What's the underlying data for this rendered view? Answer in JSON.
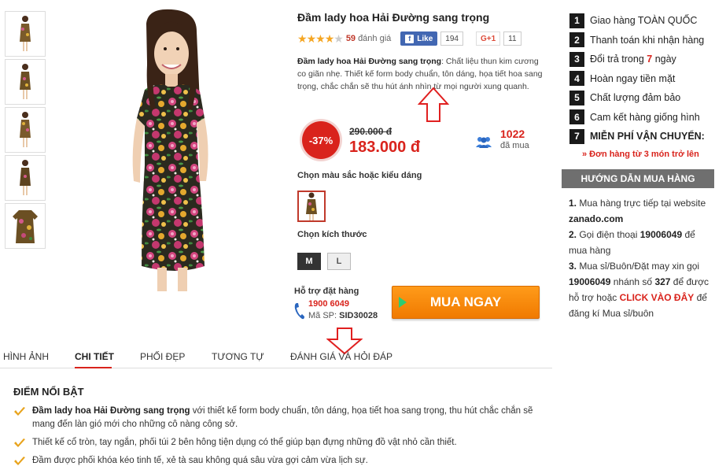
{
  "product": {
    "title": "Đầm lady hoa Hải Đường sang trọng",
    "rating_count": "59",
    "rating_label": "đánh giá",
    "rating_stars": 4,
    "fb_like_label": "Like",
    "fb_like_count": "194",
    "gplus_label": "G+1",
    "gplus_count": "11",
    "desc_bold": "Đầm lady hoa Hải Đường sang trọng",
    "desc_rest": ": Chất liệu thun kim cương co giãn nhẹ. Thiết kế form body chuẩn, tôn dáng, họa tiết hoa sang trọng, chắc chắn sẽ thu hút ánh nhìn từ mọi người xung quanh.",
    "discount": "-37%",
    "old_price": "290.000 đ",
    "new_price": "183.000 đ",
    "buyers_count": "1022",
    "buyers_label": "đã mua",
    "color_label": "Chọn màu sắc hoặc kiểu dáng",
    "size_label": "Chọn kích thước",
    "sizes": [
      "M",
      "L"
    ],
    "support_title": "Hỗ trợ đặt hàng",
    "support_phone": "1900 6049",
    "sku_label": "Mã SP:",
    "sku": "SID30028",
    "buy_label": "MUA NGAY"
  },
  "benefits": [
    {
      "num": "1",
      "pre": "Giao hàng TOÀN QUỐC",
      "hl": "",
      "post": ""
    },
    {
      "num": "2",
      "pre": "Thanh toán khi nhận hàng",
      "hl": "",
      "post": ""
    },
    {
      "num": "3",
      "pre": "Đổi trả trong ",
      "hl": "7",
      "post": " ngày"
    },
    {
      "num": "4",
      "pre": "Hoàn ngay tiền mặt",
      "hl": "",
      "post": ""
    },
    {
      "num": "5",
      "pre": "Chất lượng đảm bảo",
      "hl": "",
      "post": ""
    },
    {
      "num": "6",
      "pre": "Cam kết hàng giống hình",
      "hl": "",
      "post": ""
    },
    {
      "num": "7",
      "pre": "MIỄN PHÍ VẬN CHUYỂN:",
      "hl": "",
      "post": ""
    }
  ],
  "shipping_note": "» Đơn hàng từ 3 món trở lên",
  "guide": {
    "title": "HƯỚNG DẪN MUA HÀNG",
    "l1_num": "1.",
    "l1_text": " Mua hàng trực tiếp tại website ",
    "l1_site": "zanado.com",
    "l2_num": "2.",
    "l2_text": " Gọi điện thoại ",
    "l2_phone": "19006049",
    "l2_tail": " để mua hàng",
    "l3_num": "3.",
    "l3_text": " Mua sỉ/Buôn/Đặt may xin gọi ",
    "l3_phone": "19006049",
    "l3_mid": " nhánh số ",
    "l3_ext": "327",
    "l3_mid2": " để được hỗ trợ hoặc ",
    "l3_link": "CLICK VÀO ĐÂY",
    "l3_tail": " để đăng kí Mua sỉ/buôn"
  },
  "tabs": [
    "HÌNH ẢNH",
    "CHI TIẾT",
    "PHỐI ĐẸP",
    "TƯƠNG TỰ",
    "ĐÁNH GIÁ VÀ HỎI ĐÁP"
  ],
  "highlights": {
    "title": "ĐIỂM NỔI BẬT",
    "items": [
      {
        "bold": "Đầm lady hoa Hải Đường sang trọng",
        "text": " với thiết kế form body chuẩn, tôn dáng, họa tiết hoa sang trọng, thu hút chắc chắn sẽ mang đến làn gió mới cho những cô nàng công sở."
      },
      {
        "bold": "",
        "text": "Thiết kế cổ tròn, tay ngắn, phối túi 2 bên hông tiện dụng có thể giúp bạn đựng những đồ vật nhỏ cần thiết."
      },
      {
        "bold": "",
        "text": "Đầm được phối khóa kéo tinh tế, xẻ tà sau không quá sâu vừa gợi cảm vừa lịch sự."
      }
    ]
  },
  "colors": {
    "accent": "#d9231c",
    "buy_button": "#f07a00",
    "fb": "#4267b2",
    "guide_header": "#6f6f6f"
  }
}
